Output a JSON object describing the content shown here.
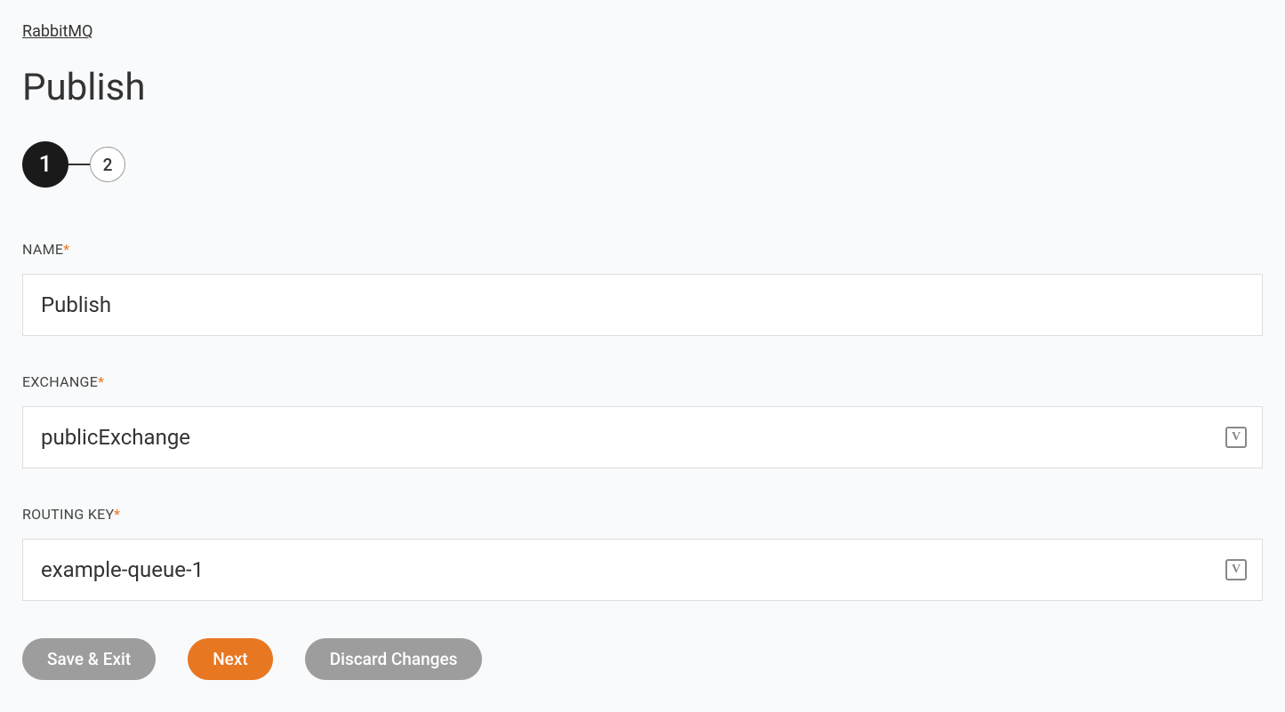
{
  "breadcrumb": {
    "label": "RabbitMQ"
  },
  "page": {
    "title": "Publish"
  },
  "stepper": {
    "steps": [
      {
        "label": "1",
        "active": true
      },
      {
        "label": "2",
        "active": false
      }
    ]
  },
  "form": {
    "name": {
      "label": "NAME",
      "required": "*",
      "value": "Publish"
    },
    "exchange": {
      "label": "EXCHANGE",
      "required": "*",
      "value": "publicExchange",
      "iconLabel": "V"
    },
    "routingKey": {
      "label": "ROUTING KEY",
      "required": "*",
      "value": "example-queue-1",
      "iconLabel": "V"
    }
  },
  "actions": {
    "saveExit": "Save & Exit",
    "next": "Next",
    "discard": "Discard Changes"
  }
}
